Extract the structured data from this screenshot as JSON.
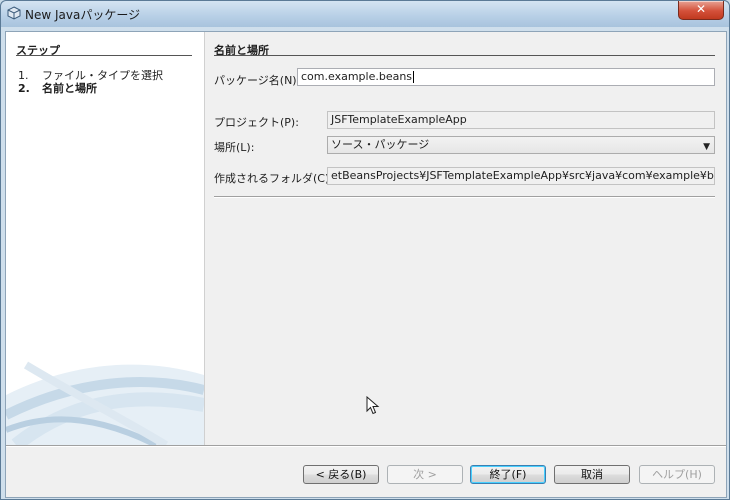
{
  "window": {
    "title": "New Javaパッケージ",
    "close_label": "✕"
  },
  "steps": {
    "heading": "ステップ",
    "items": [
      {
        "num": "1.",
        "label": "ファイル・タイプを選択"
      },
      {
        "num": "2.",
        "label": "名前と場所"
      }
    ]
  },
  "form": {
    "heading": "名前と場所",
    "package_label": "パッケージ名(N):",
    "package_value": "com.example.beans",
    "project_label": "プロジェクト(P):",
    "project_value": "JSFTemplateExampleApp",
    "location_label": "場所(L):",
    "location_value": "ソース・パッケージ",
    "folder_label": "作成されるフォルダ(C):",
    "folder_value": "etBeansProjects¥JSFTemplateExampleApp¥src¥java¥com¥example¥beans"
  },
  "buttons": {
    "back": "< 戻る(B)",
    "next": "次 >",
    "finish": "終了(F)",
    "cancel": "取消",
    "help": "ヘルプ(H)"
  }
}
